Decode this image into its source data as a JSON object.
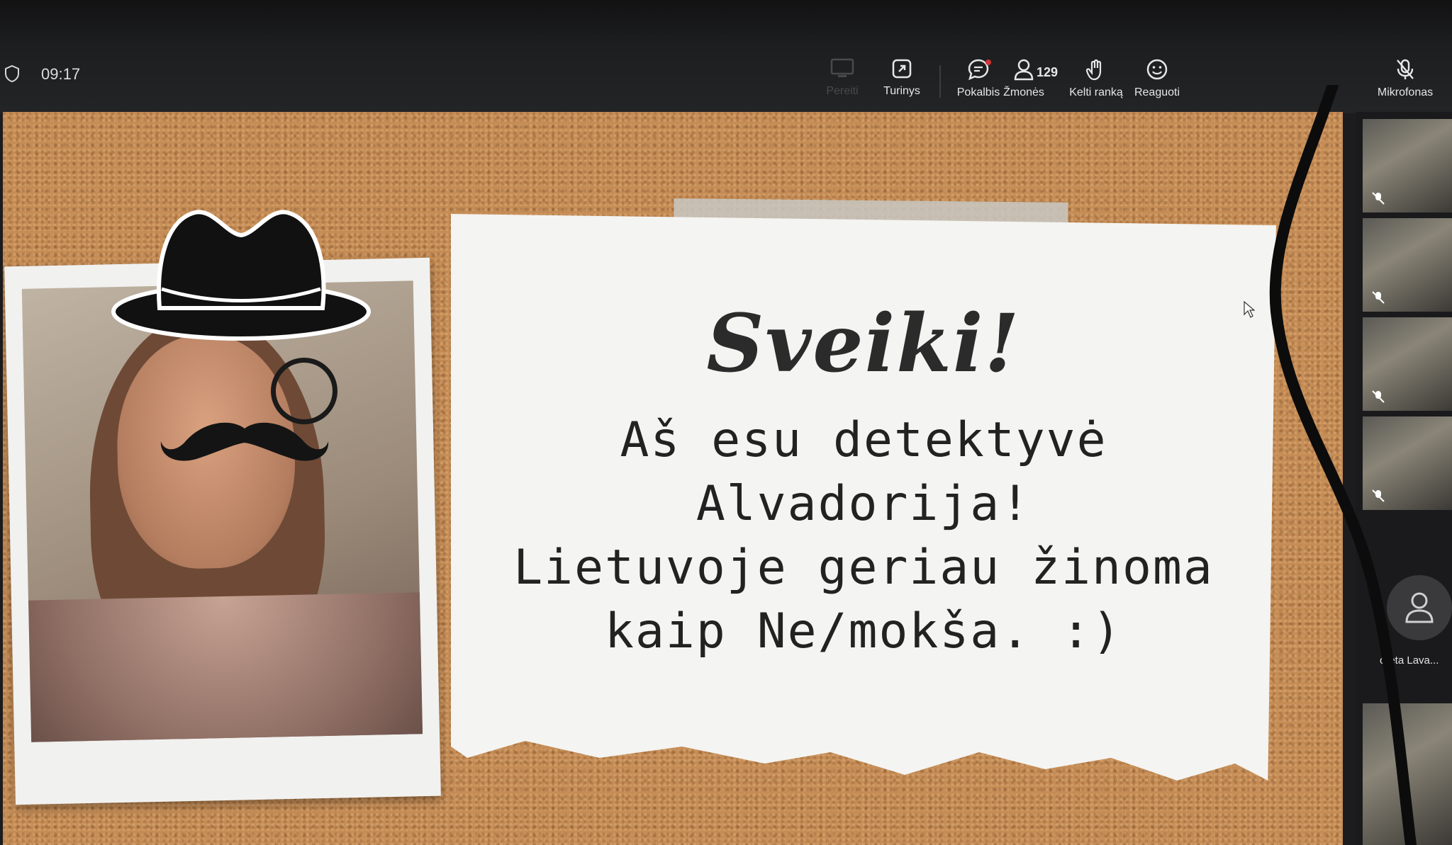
{
  "header": {
    "time": "09:17",
    "toolbar": [
      {
        "key": "share",
        "label": "Pereiti",
        "icon": "screen-share-icon",
        "disabled": true
      },
      {
        "key": "content",
        "label": "Turinys",
        "icon": "content-share-icon"
      },
      {
        "key": "chat",
        "label": "Pokalbis",
        "icon": "chat-icon"
      },
      {
        "key": "people",
        "label": "Žmonės",
        "icon": "people-icon",
        "count": "129"
      },
      {
        "key": "raise",
        "label": "Kelti ranką",
        "icon": "raise-hand-icon"
      },
      {
        "key": "react",
        "label": "Reaguoti",
        "icon": "react-smile-icon"
      },
      {
        "key": "mic",
        "label": "Mikrofonas",
        "icon": "mic-off-icon"
      }
    ]
  },
  "slide": {
    "title": "Sveiki!",
    "lines": [
      "Aš esu detektyvė",
      "Alvadorija!",
      "Lietuvoje geriau žinoma",
      "kaip Ne/mokša. :)"
    ]
  },
  "participants": {
    "avatar_name": "oreta Lava..."
  },
  "colors": {
    "cork": "#c58c55",
    "toolbar": "#1d1e20",
    "paper": "#f4f4f2"
  }
}
